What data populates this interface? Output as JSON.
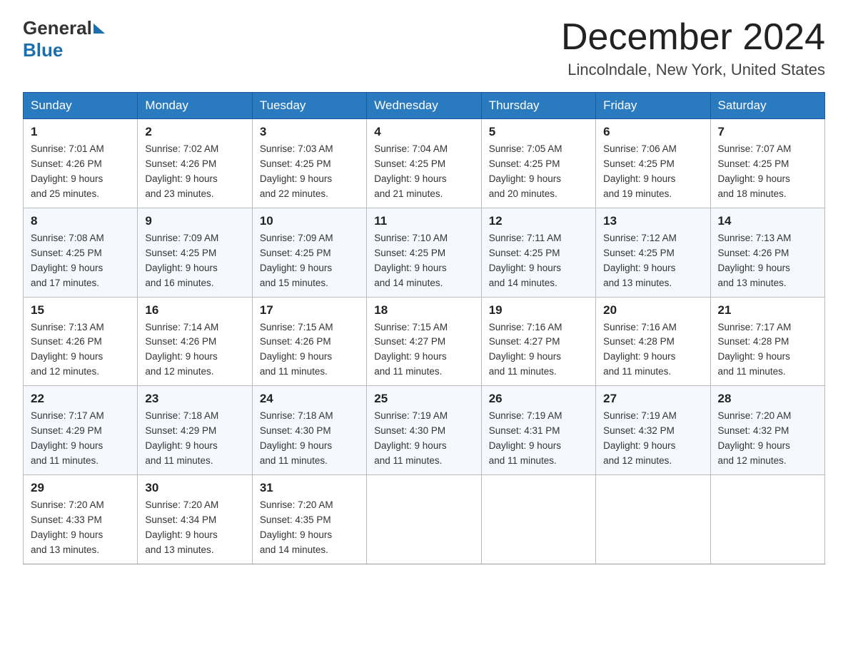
{
  "logo": {
    "general": "General",
    "blue": "Blue"
  },
  "title": "December 2024",
  "location": "Lincolndale, New York, United States",
  "days_of_week": [
    "Sunday",
    "Monday",
    "Tuesday",
    "Wednesday",
    "Thursday",
    "Friday",
    "Saturday"
  ],
  "weeks": [
    [
      {
        "day": "1",
        "sunrise": "7:01 AM",
        "sunset": "4:26 PM",
        "daylight": "9 hours and 25 minutes."
      },
      {
        "day": "2",
        "sunrise": "7:02 AM",
        "sunset": "4:26 PM",
        "daylight": "9 hours and 23 minutes."
      },
      {
        "day": "3",
        "sunrise": "7:03 AM",
        "sunset": "4:25 PM",
        "daylight": "9 hours and 22 minutes."
      },
      {
        "day": "4",
        "sunrise": "7:04 AM",
        "sunset": "4:25 PM",
        "daylight": "9 hours and 21 minutes."
      },
      {
        "day": "5",
        "sunrise": "7:05 AM",
        "sunset": "4:25 PM",
        "daylight": "9 hours and 20 minutes."
      },
      {
        "day": "6",
        "sunrise": "7:06 AM",
        "sunset": "4:25 PM",
        "daylight": "9 hours and 19 minutes."
      },
      {
        "day": "7",
        "sunrise": "7:07 AM",
        "sunset": "4:25 PM",
        "daylight": "9 hours and 18 minutes."
      }
    ],
    [
      {
        "day": "8",
        "sunrise": "7:08 AM",
        "sunset": "4:25 PM",
        "daylight": "9 hours and 17 minutes."
      },
      {
        "day": "9",
        "sunrise": "7:09 AM",
        "sunset": "4:25 PM",
        "daylight": "9 hours and 16 minutes."
      },
      {
        "day": "10",
        "sunrise": "7:09 AM",
        "sunset": "4:25 PM",
        "daylight": "9 hours and 15 minutes."
      },
      {
        "day": "11",
        "sunrise": "7:10 AM",
        "sunset": "4:25 PM",
        "daylight": "9 hours and 14 minutes."
      },
      {
        "day": "12",
        "sunrise": "7:11 AM",
        "sunset": "4:25 PM",
        "daylight": "9 hours and 14 minutes."
      },
      {
        "day": "13",
        "sunrise": "7:12 AM",
        "sunset": "4:25 PM",
        "daylight": "9 hours and 13 minutes."
      },
      {
        "day": "14",
        "sunrise": "7:13 AM",
        "sunset": "4:26 PM",
        "daylight": "9 hours and 13 minutes."
      }
    ],
    [
      {
        "day": "15",
        "sunrise": "7:13 AM",
        "sunset": "4:26 PM",
        "daylight": "9 hours and 12 minutes."
      },
      {
        "day": "16",
        "sunrise": "7:14 AM",
        "sunset": "4:26 PM",
        "daylight": "9 hours and 12 minutes."
      },
      {
        "day": "17",
        "sunrise": "7:15 AM",
        "sunset": "4:26 PM",
        "daylight": "9 hours and 11 minutes."
      },
      {
        "day": "18",
        "sunrise": "7:15 AM",
        "sunset": "4:27 PM",
        "daylight": "9 hours and 11 minutes."
      },
      {
        "day": "19",
        "sunrise": "7:16 AM",
        "sunset": "4:27 PM",
        "daylight": "9 hours and 11 minutes."
      },
      {
        "day": "20",
        "sunrise": "7:16 AM",
        "sunset": "4:28 PM",
        "daylight": "9 hours and 11 minutes."
      },
      {
        "day": "21",
        "sunrise": "7:17 AM",
        "sunset": "4:28 PM",
        "daylight": "9 hours and 11 minutes."
      }
    ],
    [
      {
        "day": "22",
        "sunrise": "7:17 AM",
        "sunset": "4:29 PM",
        "daylight": "9 hours and 11 minutes."
      },
      {
        "day": "23",
        "sunrise": "7:18 AM",
        "sunset": "4:29 PM",
        "daylight": "9 hours and 11 minutes."
      },
      {
        "day": "24",
        "sunrise": "7:18 AM",
        "sunset": "4:30 PM",
        "daylight": "9 hours and 11 minutes."
      },
      {
        "day": "25",
        "sunrise": "7:19 AM",
        "sunset": "4:30 PM",
        "daylight": "9 hours and 11 minutes."
      },
      {
        "day": "26",
        "sunrise": "7:19 AM",
        "sunset": "4:31 PM",
        "daylight": "9 hours and 11 minutes."
      },
      {
        "day": "27",
        "sunrise": "7:19 AM",
        "sunset": "4:32 PM",
        "daylight": "9 hours and 12 minutes."
      },
      {
        "day": "28",
        "sunrise": "7:20 AM",
        "sunset": "4:32 PM",
        "daylight": "9 hours and 12 minutes."
      }
    ],
    [
      {
        "day": "29",
        "sunrise": "7:20 AM",
        "sunset": "4:33 PM",
        "daylight": "9 hours and 13 minutes."
      },
      {
        "day": "30",
        "sunrise": "7:20 AM",
        "sunset": "4:34 PM",
        "daylight": "9 hours and 13 minutes."
      },
      {
        "day": "31",
        "sunrise": "7:20 AM",
        "sunset": "4:35 PM",
        "daylight": "9 hours and 14 minutes."
      },
      null,
      null,
      null,
      null
    ]
  ],
  "labels": {
    "sunrise": "Sunrise:",
    "sunset": "Sunset:",
    "daylight": "Daylight:"
  }
}
